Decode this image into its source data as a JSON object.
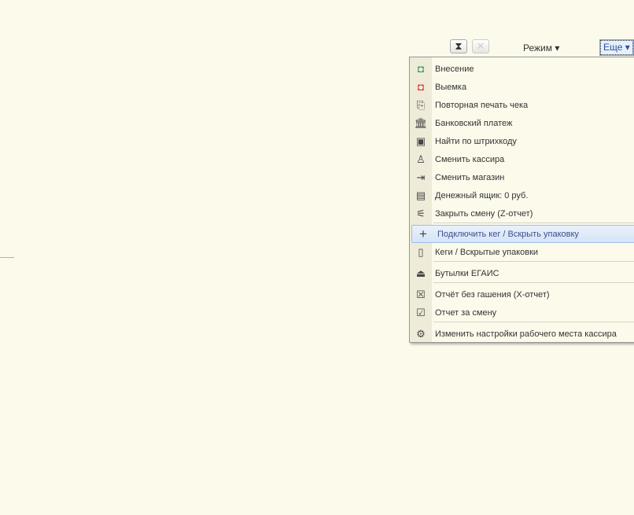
{
  "toolbar": {
    "hourglass_icon": "hourglass-icon",
    "close_icon": "close-icon",
    "mode_label": "Режим ▾",
    "more_label": "Еще ▾"
  },
  "menu": {
    "items": [
      {
        "label": "Внесение",
        "icon": "◘"
      },
      {
        "label": "Выемка",
        "icon": "◘"
      },
      {
        "label": "Повторная печать чека",
        "icon": "⎘"
      },
      {
        "label": "Банковский платеж",
        "icon": "🏛"
      },
      {
        "label": "Найти по штрихкоду",
        "icon": "▣"
      },
      {
        "label": "Сменить кассира",
        "icon": "♙"
      },
      {
        "label": "Сменить магазин",
        "icon": "⇥"
      },
      {
        "label": "Денежный ящик: 0 руб.",
        "icon": "▤"
      },
      {
        "label": "Закрыть смену (Z-отчет)",
        "icon": "⚟"
      },
      {
        "label": "Подключить кег / Вскрыть упаковку",
        "icon": "+"
      },
      {
        "label": "Кеги / Вскрытые упаковки",
        "icon": "▯"
      },
      {
        "label": "Бутылки ЕГАИС",
        "icon": "⏏"
      },
      {
        "label": "Отчёт без гашения (X-отчет)",
        "icon": "☒"
      },
      {
        "label": "Отчет за смену",
        "icon": "☑"
      },
      {
        "label": "Изменить настройки рабочего места кассира",
        "icon": "⚙"
      }
    ]
  }
}
